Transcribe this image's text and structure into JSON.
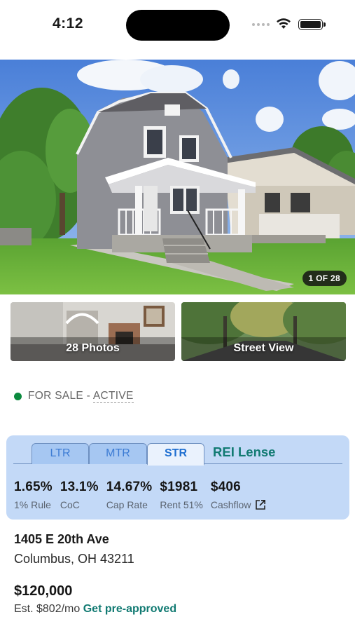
{
  "status_bar": {
    "time": "4:12"
  },
  "hero": {
    "photo_counter": "1 OF 28"
  },
  "thumbnails": {
    "photos_label": "28 Photos",
    "street_label": "Street View"
  },
  "listing": {
    "status_prefix": "FOR SALE - ",
    "status_value": "ACTIVE",
    "status_color": "#0b8a3e"
  },
  "metrics_card": {
    "tabs": [
      {
        "label": "LTR",
        "active": false
      },
      {
        "label": "MTR",
        "active": false
      },
      {
        "label": "STR",
        "active": true
      }
    ],
    "brand": "REI Lense",
    "metrics": [
      {
        "value": "1.65%",
        "label": "1% Rule"
      },
      {
        "value": "13.1%",
        "label": "CoC"
      },
      {
        "value": "14.67%",
        "label": "Cap Rate"
      },
      {
        "value": "$1981",
        "label": "Rent 51%"
      },
      {
        "value": "$406",
        "label": "Cashflow"
      }
    ]
  },
  "address": {
    "line1": "1405 E 20th Ave",
    "line2": "Columbus, OH 43211"
  },
  "pricing": {
    "price": "$120,000",
    "estimate": "Est. $802/mo",
    "preapproved_link": "Get pre-approved"
  },
  "colors": {
    "accent_teal": "#117a72",
    "tab_blue": "#3d7cd4",
    "card_bg": "#c3d9f7"
  }
}
